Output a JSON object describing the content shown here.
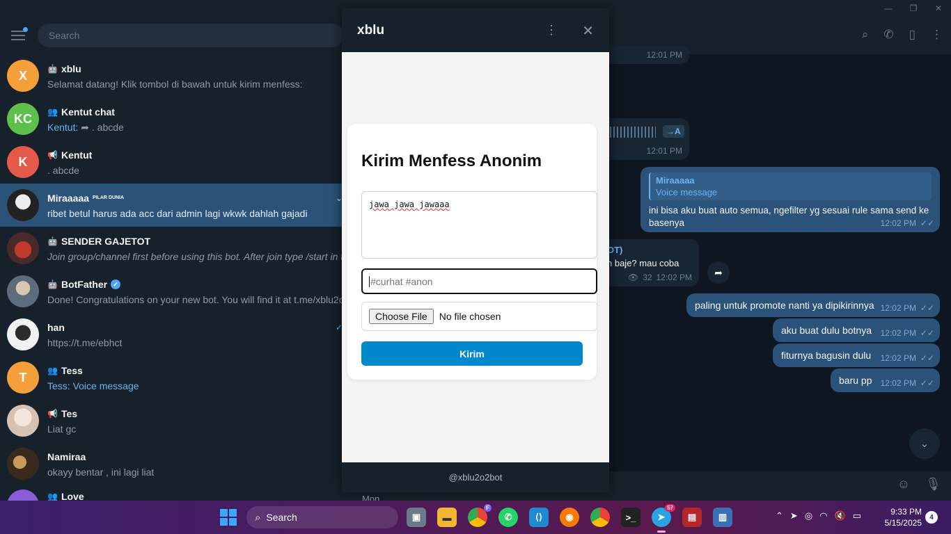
{
  "search_placeholder": "Search",
  "chats": [
    {
      "initials": "X",
      "color": "#f59f3a",
      "kind": "bot",
      "name": "xblu",
      "preview": "Selamat datang! Klik tombol di bawah untuk kirim menfess:"
    },
    {
      "initials": "KC",
      "color": "#5fbf4b",
      "kind": "group",
      "name": "Kentut chat",
      "sender": "Kentut:",
      "preview": " ➦ . abcde"
    },
    {
      "initials": "K",
      "color": "#e5594a",
      "kind": "channel",
      "name": "Kentut",
      "preview": ". abcde"
    },
    {
      "initials": "",
      "color": "#222",
      "kind": "user",
      "name": "Miraaaaa",
      "badge": "PILAR DUNIA",
      "preview": "ribet betul harus ada acc dari admin lagi wkwk dahlah gajadi"
    },
    {
      "initials": "",
      "color": "#7a3b35",
      "kind": "bot",
      "name": "SENDER GAJETOT",
      "preview": "Join group/channel first before using this bot.  After join type /start in this bot"
    },
    {
      "initials": "",
      "color": "#5d6b7a",
      "kind": "bot",
      "name": "BotFather",
      "preview": "Done! Congratulations on your new bot. You will find it at t.me/xblu2o2bot"
    },
    {
      "initials": "",
      "color": "#ddd",
      "kind": "user",
      "name": "han",
      "preview": "https://t.me/ebhct"
    },
    {
      "initials": "T",
      "color": "#f59f3a",
      "kind": "group",
      "name": "Tess",
      "preview": "Tess: Voice message"
    },
    {
      "initials": "",
      "color": "#e8d8cf",
      "kind": "channel",
      "name": "Tes",
      "preview": "Liat gc"
    },
    {
      "initials": "",
      "color": "#3a2a1e",
      "kind": "user",
      "name": "Namiraa",
      "preview": "okayy bentar , ini lagi liat"
    },
    {
      "initials": "",
      "color": "#8a5cd6",
      "kind": "group",
      "name": "Love",
      "preview": ""
    }
  ],
  "messages": {
    "time_top": "12:01 PM",
    "voice_time": "12:01 PM",
    "voice_transcribe": "→A",
    "reply_name": "Miraaaaa",
    "reply_text": "Voice message",
    "msg1": "ini bisa aku buat auto semua, ngefilter yg sesuai rule sama send ke basenya",
    "msg1_time": "12:02 PM",
    "fwd_header": "OT)",
    "fwd_text": "n baje? mau coba",
    "fwd_views": "32",
    "fwd_time": "12:02 PM",
    "out": [
      {
        "text": "paling untuk promote nanti ya dipikirinnya",
        "time": "12:02 PM"
      },
      {
        "text": "aku buat dulu botnya",
        "time": "12:02 PM"
      },
      {
        "text": "fiturnya bagusin dulu",
        "time": "12:02 PM"
      },
      {
        "text": "baru pp",
        "time": "12:02 PM"
      }
    ],
    "day": "Mon"
  },
  "popup": {
    "title": "xblu",
    "footer": "@xblu2o2bot",
    "form_title": "Kirim Menfess Anonim",
    "message_value": "jawa jawa jawaaa",
    "tag_placeholder": "#curhat #anon",
    "file_button": "Choose File",
    "file_status": "No file chosen",
    "send_label": "Kirim"
  },
  "taskbar": {
    "search": "Search",
    "telegram_badge": "57",
    "chrome_badge": "F",
    "time": "9:33 PM",
    "date": "5/15/2025",
    "notifications": "4"
  },
  "colors": {
    "accent": "#0088cc",
    "sidebar_active": "#2b5278",
    "outgoing_bubble": "#2b5278",
    "incoming_bubble": "#182533"
  }
}
